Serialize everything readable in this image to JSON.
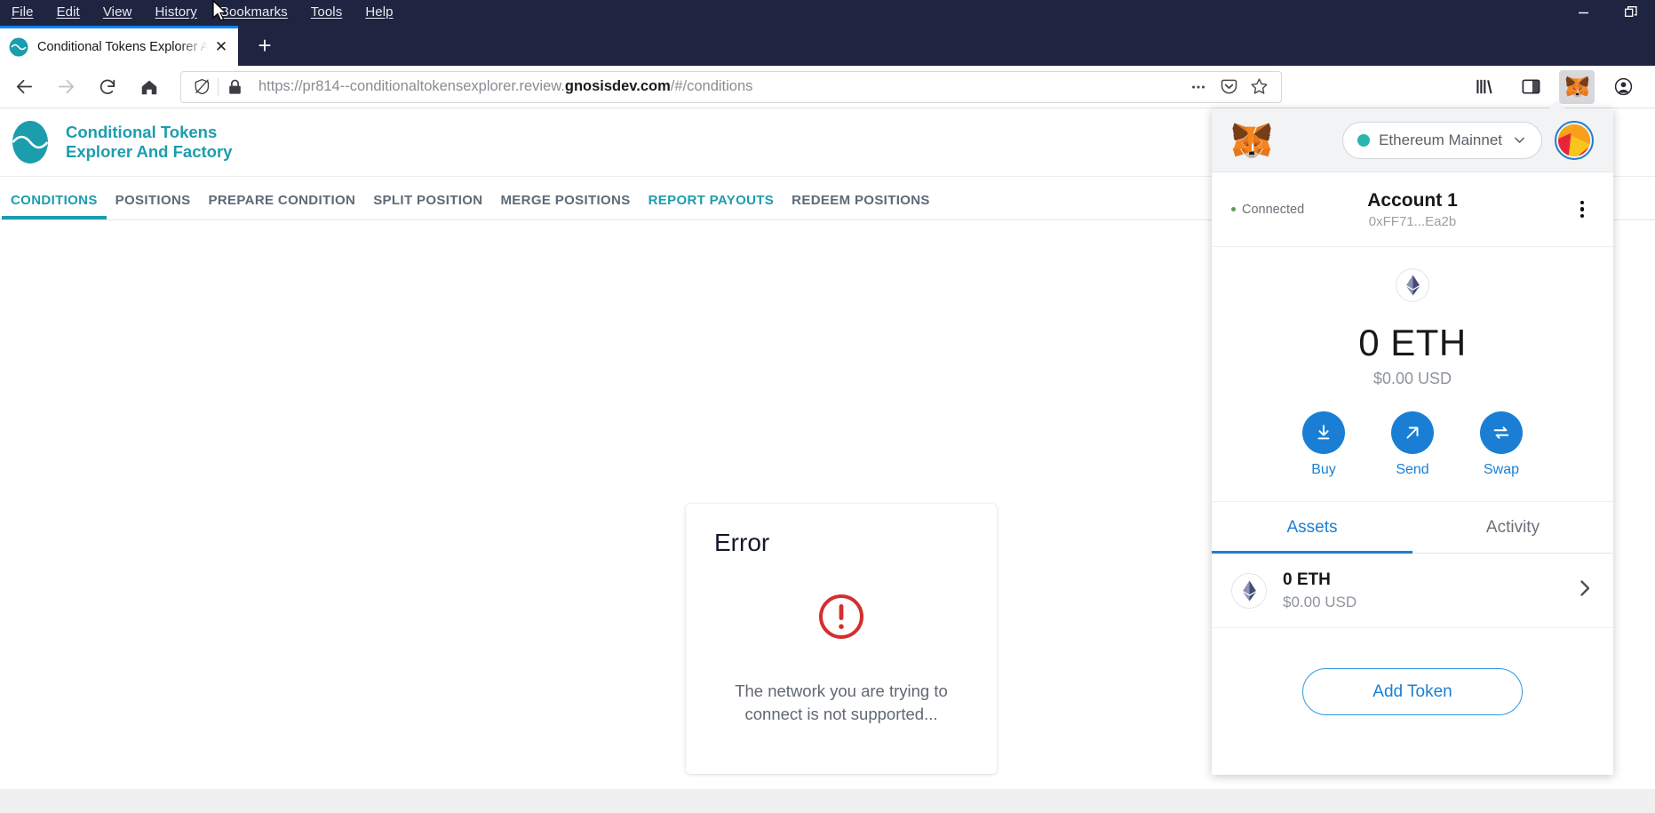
{
  "browser": {
    "menus": [
      "File",
      "Edit",
      "View",
      "History",
      "Bookmarks",
      "Tools",
      "Help"
    ],
    "window_controls": {
      "minimize": "minimize-button",
      "restore": "restore-button"
    },
    "tab": {
      "title": "Conditional Tokens Explorer An",
      "close_label": "✕",
      "newtab_label": "+"
    },
    "url": {
      "prefix": "https://pr814--conditionaltokensexplorer.review.",
      "domain": "gnosisdev.com",
      "suffix": "/#/conditions"
    },
    "toolbar_right_icons": [
      "library-icon",
      "sidebar-icon",
      "metamask-extension-icon",
      "account-icon"
    ],
    "urlbar_right_icons": [
      "page-actions-icon",
      "pocket-icon",
      "bookmark-star-icon"
    ]
  },
  "site": {
    "logo_line1": "Conditional Tokens",
    "logo_line2": "Explorer And Factory",
    "brand_color": "#1c9dad",
    "nav": [
      {
        "label": "CONDITIONS",
        "state": "active"
      },
      {
        "label": "POSITIONS",
        "state": "default"
      },
      {
        "label": "PREPARE CONDITION",
        "state": "default"
      },
      {
        "label": "SPLIT POSITION",
        "state": "default"
      },
      {
        "label": "MERGE POSITIONS",
        "state": "default"
      },
      {
        "label": "REPORT PAYOUTS",
        "state": "accent"
      },
      {
        "label": "REDEEM POSITIONS",
        "state": "default"
      }
    ]
  },
  "error_card": {
    "title": "Error",
    "icon": "error-exclamation-circle-icon",
    "icon_color": "#d32f2f",
    "message": "The network you are trying to connect is not supported..."
  },
  "metamask": {
    "network": "Ethereum Mainnet",
    "network_dot_color": "#29b6af",
    "connected_label": "Connected",
    "account_name": "Account 1",
    "account_address": "0xFF71...Ea2b",
    "balance": "0 ETH",
    "balance_fiat": "$0.00 USD",
    "actions": [
      {
        "label": "Buy",
        "icon": "download-arrow-icon"
      },
      {
        "label": "Send",
        "icon": "diagonal-arrow-icon"
      },
      {
        "label": "Swap",
        "icon": "swap-arrows-icon"
      }
    ],
    "tabs": [
      {
        "label": "Assets",
        "state": "active"
      },
      {
        "label": "Activity",
        "state": "default"
      }
    ],
    "assets": [
      {
        "amount": "0 ETH",
        "fiat": "$0.00 USD",
        "icon": "ethereum-icon"
      }
    ],
    "add_token_label": "Add Token",
    "accent_color": "#1a7fd4"
  }
}
